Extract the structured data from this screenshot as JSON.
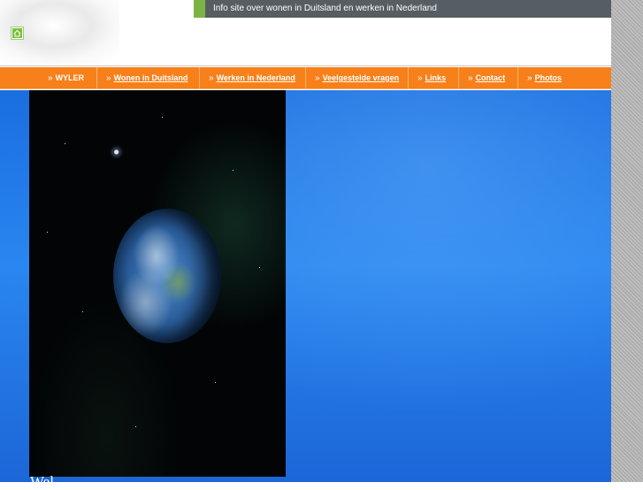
{
  "header": {
    "tagline": "Info site over wonen in Duitsland en werken in Nederland",
    "home_icon": "home-icon"
  },
  "nav": {
    "items": [
      {
        "label": "WYLER",
        "link": false
      },
      {
        "label": "Wonen in Duitsland",
        "link": true
      },
      {
        "label": "Werken in Nederland",
        "link": true
      },
      {
        "label": "Veelgestelde vragen",
        "link": true
      },
      {
        "label": "Links",
        "link": true
      },
      {
        "label": "Contact",
        "link": true
      },
      {
        "label": "Photos",
        "link": true
      }
    ],
    "arrow": "»"
  },
  "hero": {
    "image": "earth-from-space",
    "welcome": "Wel"
  },
  "colors": {
    "topbar": "#565e63",
    "accent_green": "#7cb342",
    "nav_orange": "#f7801a",
    "hero_blue": "#1a6ee0"
  }
}
